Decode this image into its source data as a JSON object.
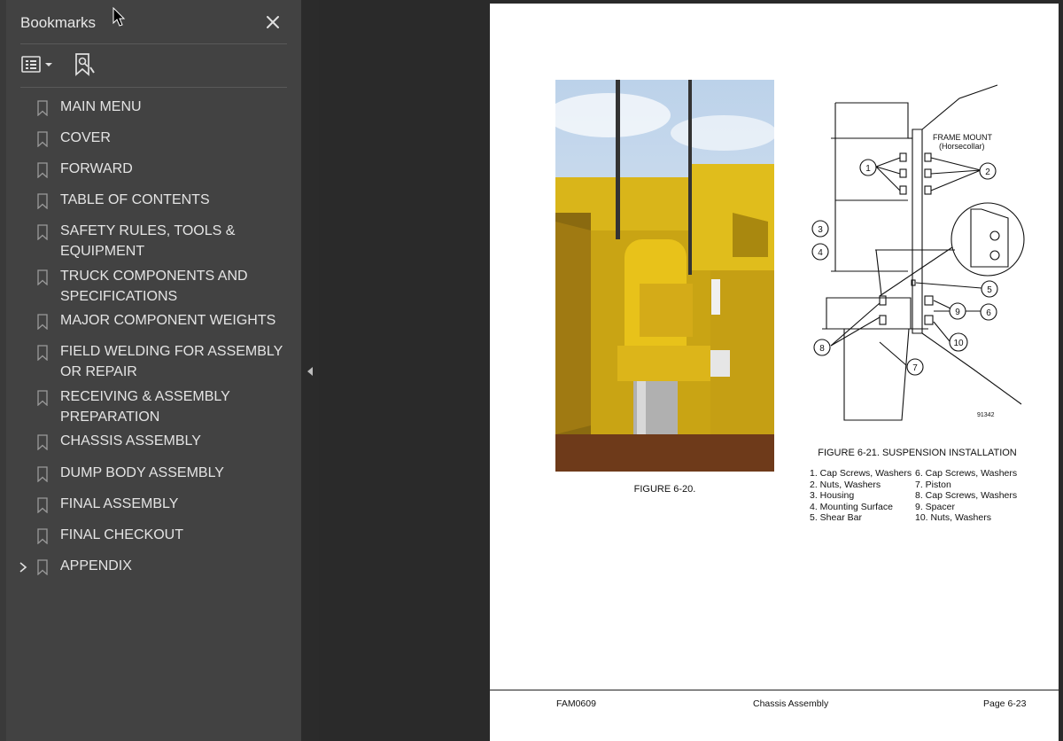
{
  "bookmarks_panel": {
    "title": "Bookmarks",
    "items": [
      {
        "label": "MAIN MENU",
        "expandable": false
      },
      {
        "label": "COVER",
        "expandable": false
      },
      {
        "label": "FORWARD",
        "expandable": false
      },
      {
        "label": "TABLE OF CONTENTS",
        "expandable": false
      },
      {
        "label": "SAFETY RULES, TOOLS & EQUIPMENT",
        "expandable": false
      },
      {
        "label": "TRUCK COMPONENTS AND SPECIFICATIONS",
        "expandable": false
      },
      {
        "label": "MAJOR COMPONENT WEIGHTS",
        "expandable": false
      },
      {
        "label": "FIELD WELDING FOR ASSEMBLY OR REPAIR",
        "expandable": false
      },
      {
        "label": "RECEIVING & ASSEMBLY PREPARATION",
        "expandable": false
      },
      {
        "label": "CHASSIS ASSEMBLY",
        "expandable": false
      },
      {
        "label": "DUMP BODY ASSEMBLY",
        "expandable": false
      },
      {
        "label": "FINAL ASSEMBLY",
        "expandable": false
      },
      {
        "label": "FINAL CHECKOUT",
        "expandable": false
      },
      {
        "label": "APPENDIX",
        "expandable": true
      }
    ]
  },
  "page": {
    "figure_20_caption": "FIGURE 6-20.",
    "figure_21_title": "FIGURE 6-21. SUSPENSION INSTALLATION",
    "diagram_labels": {
      "frame_mount": "FRAME MOUNT",
      "horsecollar": "(Horsecollar)",
      "drawing_number": "91342"
    },
    "legend_left": [
      "1. Cap Screws, Washers",
      "2. Nuts, Washers",
      "3. Housing",
      "4. Mounting Surface",
      "5. Shear Bar"
    ],
    "legend_right": [
      "6. Cap Screws, Washers",
      "7. Piston",
      "8. Cap Screws, Washers",
      "9. Spacer",
      "10. Nuts, Washers"
    ],
    "footer": {
      "left": "FAM0609",
      "center": "Chassis Assembly",
      "right": "Page 6-23"
    }
  },
  "colors": {
    "panel_bg": "#424242",
    "doc_bg": "#2a2a2a",
    "page_bg": "#ffffff",
    "photo_yellow": "#e8c21a"
  },
  "icons": [
    "close-icon",
    "options-icon",
    "find-bookmark-icon",
    "bookmark-icon",
    "chevron-right-icon",
    "collapse-arrow-icon"
  ]
}
